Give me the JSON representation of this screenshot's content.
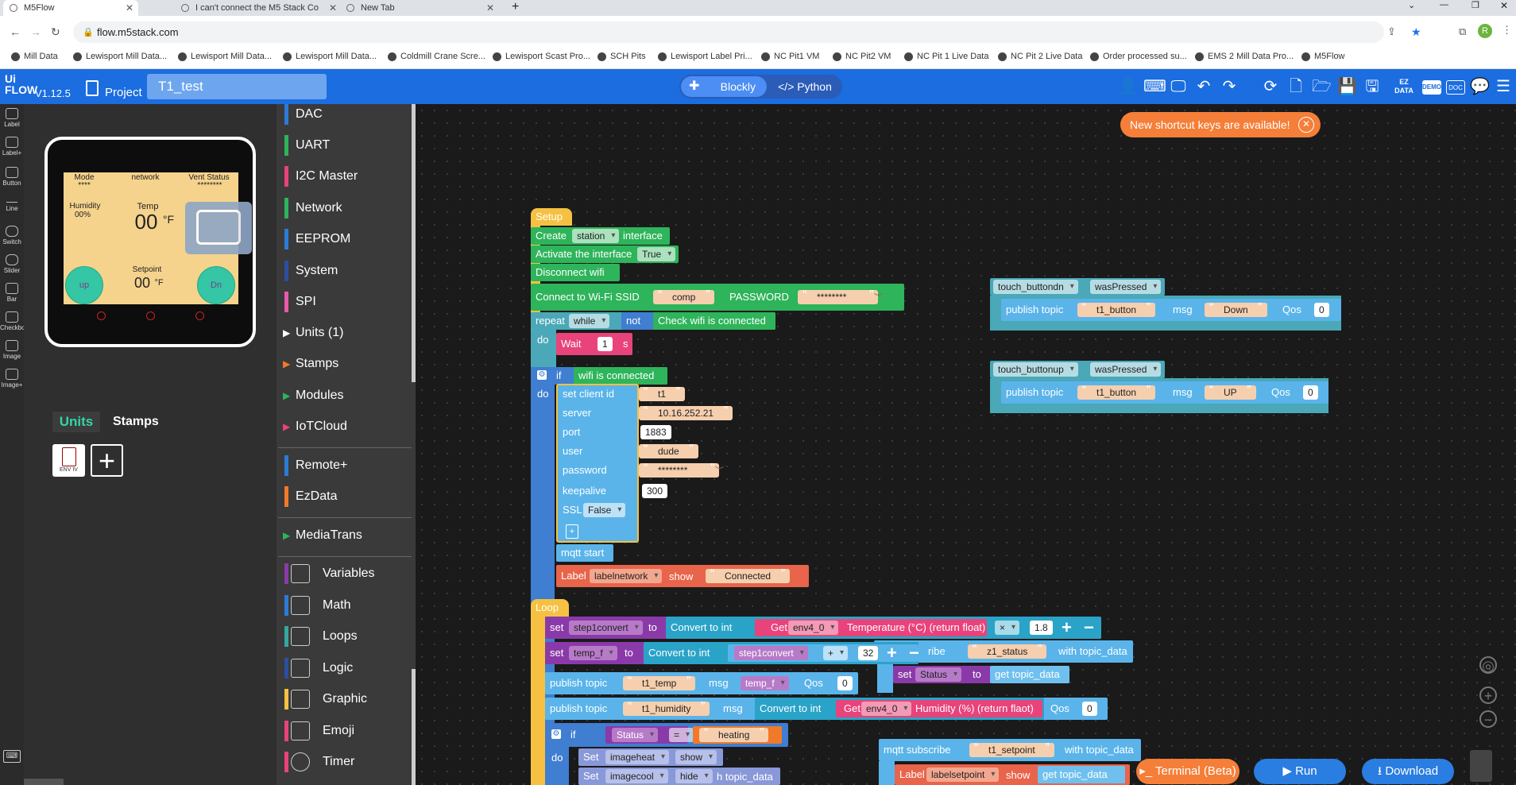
{
  "browser": {
    "tabs": [
      {
        "title": "M5Flow"
      },
      {
        "title": "I can't connect the M5 Stack Co"
      },
      {
        "title": "New Tab"
      }
    ],
    "url": "flow.m5stack.com",
    "bookmarks": [
      "Mill Data",
      "Lewisport Mill Data...",
      "Lewisport Mill Data...",
      "Lewisport Mill Data...",
      "Coldmill Crane Scre...",
      "Lewisport Scast Pro...",
      "SCH Pits",
      "Lewisport Label Pri...",
      "NC Pit1 VM",
      "NC Pit2 VM",
      "NC Pit 1 Live Data",
      "NC Pit 2 Live Data",
      "Order processed su...",
      "EMS 2 Mill Data Pro...",
      "M5Flow"
    ],
    "profile_initial": "R"
  },
  "header": {
    "logo": "Ui FLOW",
    "version": "V1.12.5",
    "project_label": "Project",
    "project_name": "T1_test",
    "blockly_label": "Blockly",
    "python_label": "Python",
    "ez_label": "EZ DATA",
    "demo_label": "DEMO",
    "doc_label": "DOC"
  },
  "toast": {
    "text": "New shortcut keys are available!"
  },
  "tools": [
    "Label",
    "Label+",
    "Button",
    "Line",
    "Switch",
    "Slider",
    "Bar",
    "Checkbox",
    "Image",
    "Image+"
  ],
  "device_screen": {
    "mode_label": "Mode",
    "mode_value": "****",
    "network_label": "network",
    "vent_label": "Vent Status",
    "vent_value": "********",
    "humidity_label": "Humidity",
    "humidity_value": "00%",
    "temp_label": "Temp",
    "temp_value": "00",
    "temp_unit": "°F",
    "setpoint_label": "Setpoint",
    "setpoint_value": "00",
    "setpoint_unit": "°F",
    "up_label": "up",
    "dn_label": "Dn"
  },
  "panel_tabs": {
    "units": "Units",
    "stamps": "Stamps",
    "env_unit": "ENV IV",
    "add": "+"
  },
  "categories": [
    {
      "label": "DAC",
      "color": "#2b7bd6"
    },
    {
      "label": "UART",
      "color": "#2eb45a"
    },
    {
      "label": "I2C Master",
      "color": "#e8437a"
    },
    {
      "label": "Network",
      "color": "#2eb45a"
    },
    {
      "label": "EEPROM",
      "color": "#2b7bd6"
    },
    {
      "label": "System",
      "color": "#2b4fa0"
    },
    {
      "label": "SPI",
      "color": "#e85aa8"
    },
    {
      "label": "Units (1)",
      "color": "",
      "arrow": "▶"
    },
    {
      "label": "Stamps",
      "color": "",
      "arrow": "▶"
    },
    {
      "label": "Modules",
      "color": "#2eb45a",
      "arrow": "▶"
    },
    {
      "label": "IoTCloud",
      "color": "#e8437a",
      "arrow": "▶"
    },
    {
      "label": "Remote+",
      "color": "#2b7bd6"
    },
    {
      "label": "EzData",
      "color": "#f07a2a"
    },
    {
      "label": "MediaTrans",
      "color": "#2eb45a",
      "arrow": "▶"
    },
    {
      "label": "Variables",
      "color": "#8a3aa8"
    },
    {
      "label": "Math",
      "color": "#2b7bd6"
    },
    {
      "label": "Loops",
      "color": "#34a8a0"
    },
    {
      "label": "Logic",
      "color": "#2b4fa0"
    },
    {
      "label": "Graphic",
      "color": "#f6c142"
    },
    {
      "label": "Emoji",
      "color": "#e8437a"
    },
    {
      "label": "Timer",
      "color": "#e8437a"
    }
  ],
  "blocks": {
    "setup": "Setup",
    "create": "Create",
    "station": "station",
    "interface": "interface",
    "activate": "Activate the interface",
    "true_val": "True",
    "disconnect": "Disconnect wifi",
    "connect": "Connect to Wi-Fi SSID",
    "ssid": "comp",
    "password_label": "PASSWORD",
    "password_val": "********",
    "repeat": "repeat",
    "while": "while",
    "not": "not",
    "check_wifi": "Check wifi is connected",
    "do": "do",
    "wait": "Wait",
    "wait_val": "1",
    "wait_unit": "s",
    "if": "if",
    "wifi_connected": "wifi is connected",
    "set_client": "set client id",
    "client_val": "t1",
    "server": "server",
    "server_val": "10.16.252.21",
    "port": "port",
    "port_val": "1883",
    "user": "user",
    "user_val": "dude",
    "password": "password",
    "mqtt_pass_val": "********",
    "keepalive": "keepalive",
    "keepalive_val": "300",
    "ssl": "SSL",
    "ssl_val": "False",
    "mqtt_start": "mqtt start",
    "label": "Label",
    "labelnetwork": "labelnetwork",
    "show": "show",
    "connected": "Connected",
    "loop": "Loop",
    "set": "set",
    "step1convert": "step1convert",
    "to": "to",
    "convert_int": "Convert to int",
    "get": "Get",
    "env4": "env4_0",
    "temp_float": "Temperature (°C) (return float)",
    "mul": "×",
    "mul_val": "1.8",
    "temp_f": "temp_f",
    "plus": "+",
    "plus_val": "32",
    "publish": "publish topic",
    "t1_temp": "t1_temp",
    "msg": "msg",
    "qos": "Qos",
    "qos_val": "0",
    "t1_humidity": "t1_humidity",
    "hum_float": "Humidity (%) (return flaot)",
    "status": "Status",
    "eq": "=",
    "heating": "heating",
    "set_img": "Set",
    "imageheat": "imageheat",
    "show_opt": "show",
    "imagecool": "imagecool",
    "hide_opt": "hide",
    "topic_data_frag": "h topic_data",
    "subscribe_frag": "ribe",
    "z1_status": "z1_status",
    "with_topic": "with topic_data",
    "set_status": "set",
    "status_var": "Status",
    "get_topic": "get topic_data",
    "mqtt_subscribe": "mqtt subscribe",
    "t1_setpoint": "t1_setpoint",
    "labelsetpoint": "labelsetpoint",
    "touch_dn": "touch_buttondn",
    "was_pressed": "wasPressed",
    "t1_button": "t1_button",
    "down": "Down",
    "touch_up": "touch_buttonup",
    "up": "UP"
  },
  "bottom": {
    "terminal": "Terminal (Beta)",
    "run": "Run",
    "download": "Download"
  }
}
